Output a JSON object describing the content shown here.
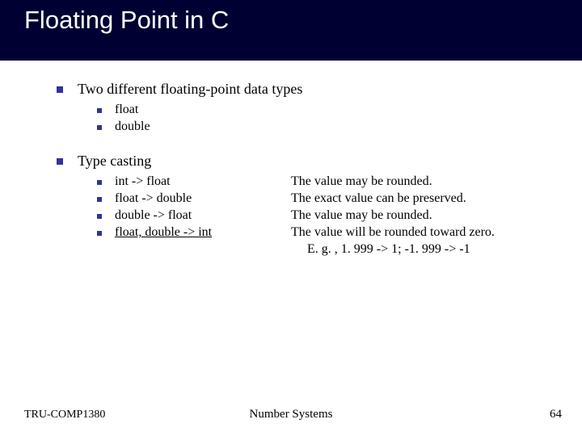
{
  "title": "Floating Point in C",
  "bullets": {
    "b1": "Two different floating-point data types",
    "b1_1": "float",
    "b1_2": "double",
    "b2": "Type casting",
    "c1_left": "int -> float",
    "c1_right": "The value may be rounded.",
    "c2_left": "float -> double",
    "c2_right": "The exact value can be preserved.",
    "c3_left": "double -> float",
    "c3_right": "The value may be rounded.",
    "c4_left": "float, double -> int",
    "c4_right": "The value will be rounded toward zero.",
    "c4_example": "E. g. , 1. 999 -> 1; -1. 999 -> -1"
  },
  "footer": {
    "left": "TRU-COMP1380",
    "center": "Number Systems",
    "right": "64"
  }
}
